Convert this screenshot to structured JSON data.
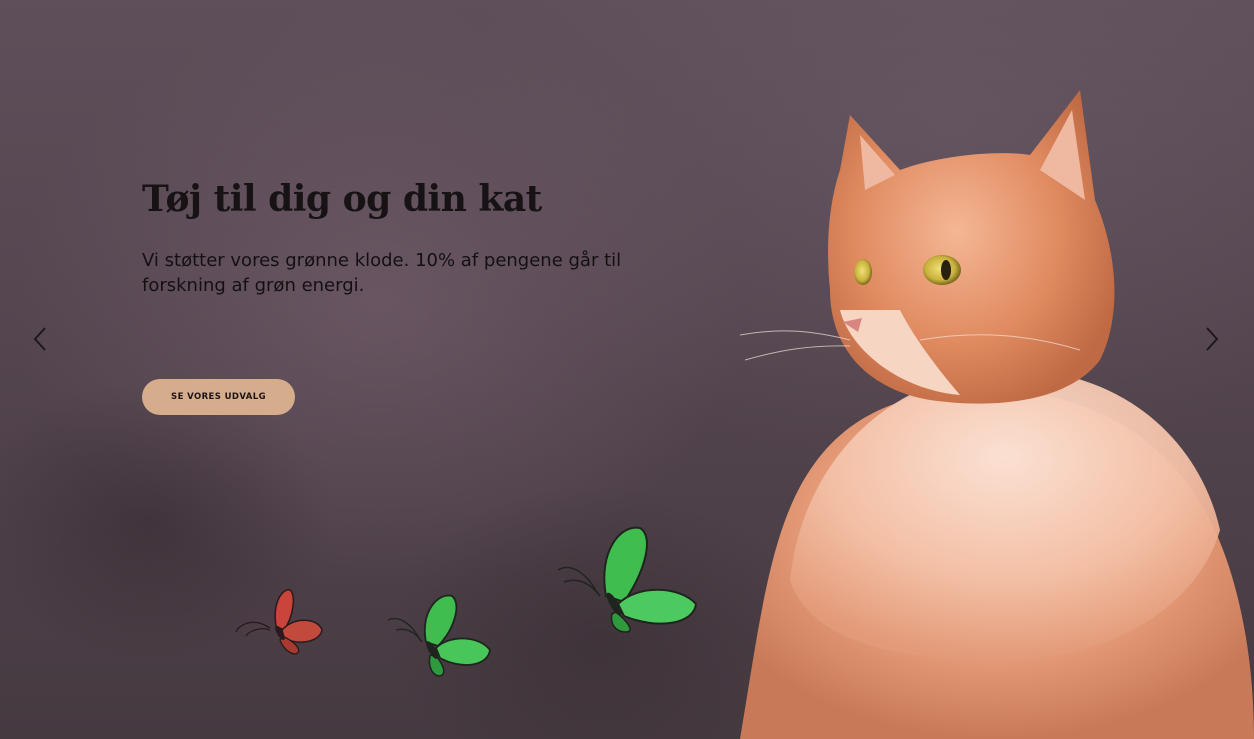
{
  "hero": {
    "title": "Tøj til dig og din kat",
    "subtitle": "Vi støtter vores grønne klode. 10% af pengene går til forskning af grøn energi.",
    "cta_label": "SE VORES UDVALG"
  },
  "carousel": {
    "prev_icon": "chevron-left-icon",
    "next_icon": "chevron-right-icon"
  },
  "colors": {
    "cta_background": "#d5ac8c",
    "text": "#171214",
    "cat_fur": "#e79a72",
    "butterfly_red": "#c9443a",
    "butterfly_green": "#3fbd4f"
  }
}
